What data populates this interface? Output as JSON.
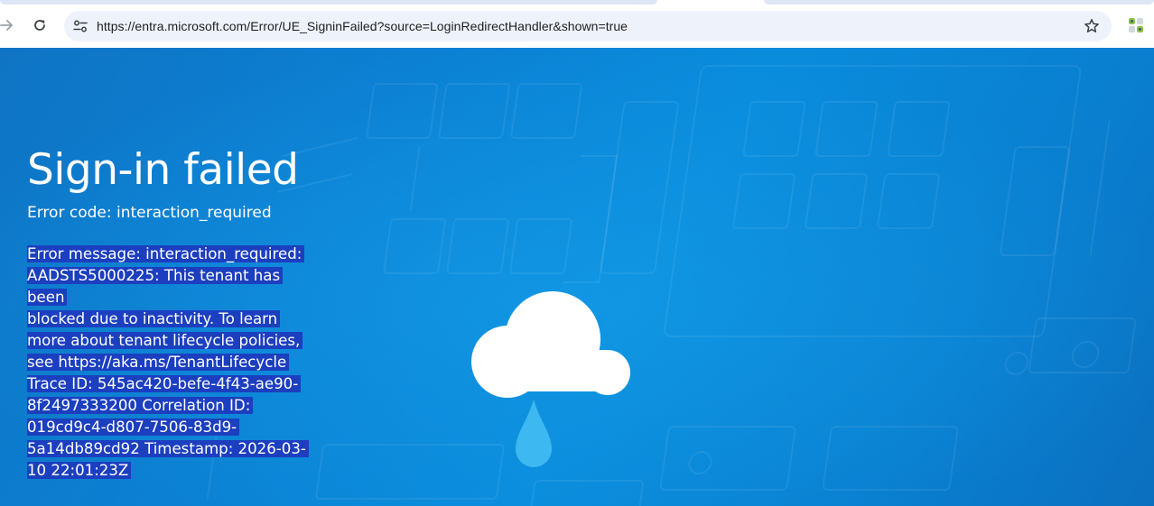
{
  "browser": {
    "url": "https://entra.microsoft.com/Error/UE_SigninFailed?source=LoginRedirectHandler&shown=true",
    "icons": {
      "forward": "arrow-right-icon",
      "reload": "reload-icon",
      "site_info": "tune-icon",
      "bookmark": "star-icon",
      "extension": "extension-icon"
    }
  },
  "page": {
    "title": "Sign-in failed",
    "error_code": "Error code: interaction_required",
    "error_message_lines": [
      "Error message: interaction_required:",
      "AADSTS5000225: This tenant has been",
      "blocked due to inactivity. To learn",
      "more about tenant lifecycle policies,",
      "see https://aka.ms/TenantLifecycle",
      "Trace ID: 545ac420-befe-4f43-ae90-",
      "8f2497333200 Correlation ID:",
      "019cd9c4-d807-7506-83d9-",
      "5a14db89cd92 Timestamp: 2026-03-",
      "10 22:01:23Z"
    ],
    "illustration": "cloud-rain-icon"
  },
  "colors": {
    "background": "#0a84d6",
    "selection": "#1c3fbf",
    "text": "#ffffff",
    "raindrop": "#3db8f0"
  }
}
